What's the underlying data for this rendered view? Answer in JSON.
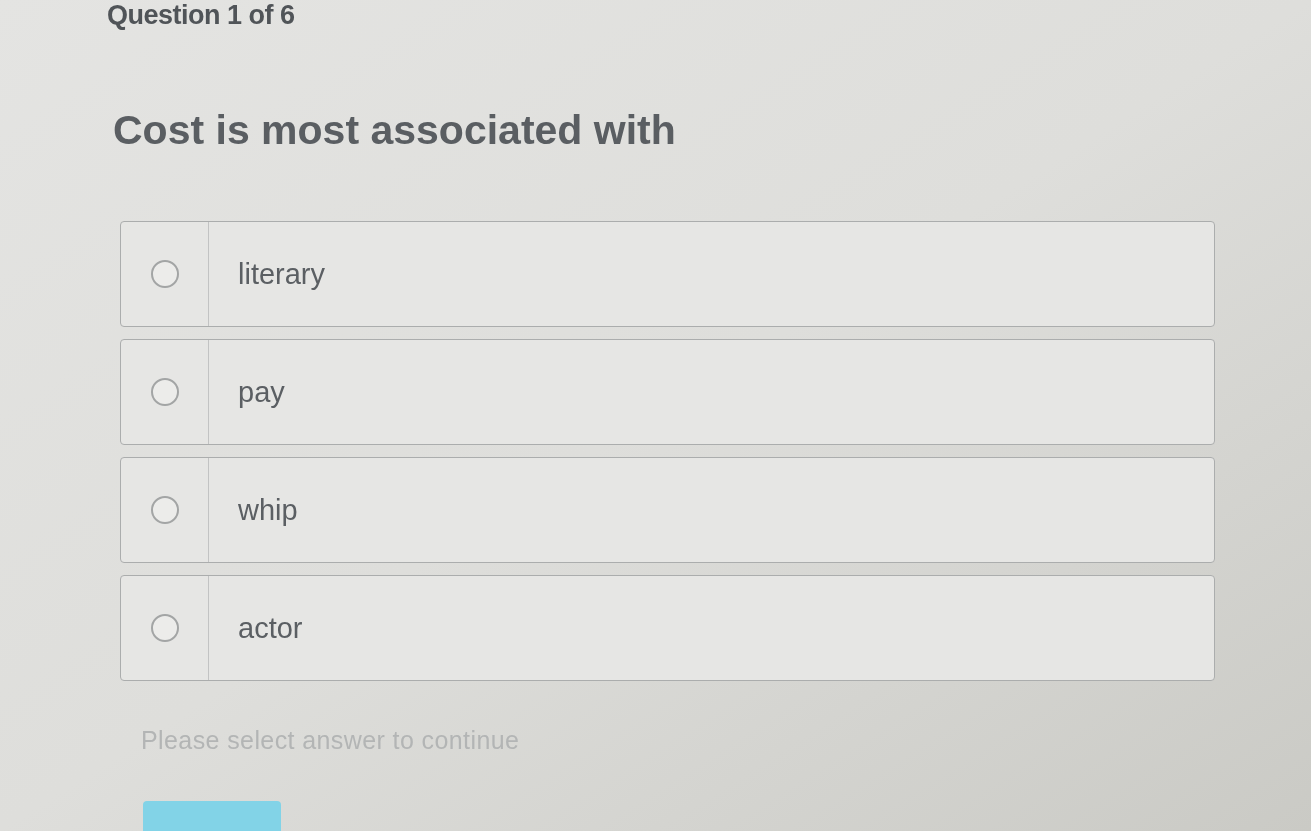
{
  "question_counter": "Question 1 of 6",
  "question": "Cost is most associated with",
  "options": [
    {
      "label": "literary",
      "selected": false
    },
    {
      "label": "pay",
      "selected": false
    },
    {
      "label": "whip",
      "selected": false
    },
    {
      "label": "actor",
      "selected": false
    }
  ],
  "hint": "Please select answer to continue",
  "button": {
    "disabled": true
  }
}
